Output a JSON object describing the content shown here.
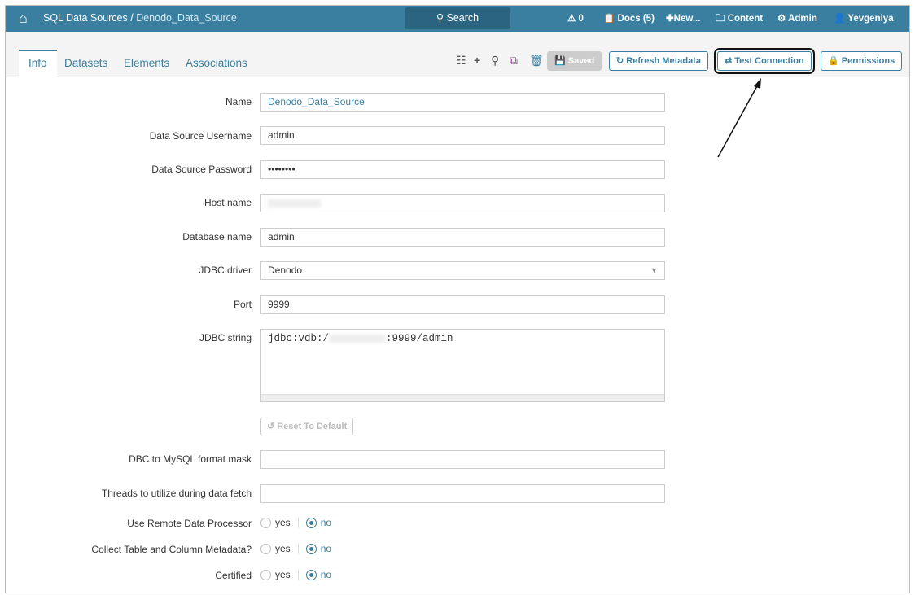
{
  "header": {
    "section": "SQL Data Sources",
    "separator": " / ",
    "current": "Denodo_Data_Source",
    "search": "Search",
    "alerts": "0",
    "docs": "Docs (5)",
    "new": "New...",
    "content": "Content",
    "admin": "Admin",
    "user": "Yevgeniya"
  },
  "tabs": [
    "Info",
    "Datasets",
    "Elements",
    "Associations"
  ],
  "toolbar": {
    "saved": "Saved",
    "refresh": "Refresh Metadata",
    "test": "Test Connection",
    "permissions": "Permissions"
  },
  "form": {
    "name_label": "Name",
    "name": "Denodo_Data_Source",
    "user_label": "Data Source Username",
    "user": "admin",
    "pass_label": "Data Source Password",
    "pass": "••••••••",
    "host_label": "Host name",
    "db_label": "Database name",
    "db": "admin",
    "driver_label": "JDBC driver",
    "driver": "Denodo",
    "port_label": "Port",
    "port": "9999",
    "jdbc_label": "JDBC string",
    "jdbc_prefix": "jdbc:vdb:/",
    "jdbc_suffix": ":9999/admin",
    "reset": "Reset To Default",
    "mask_label": "DBC to MySQL format mask",
    "threads_label": "Threads to utilize during data fetch",
    "radios": [
      {
        "label": "Use Remote Data Processor",
        "yes": "yes",
        "no": "no"
      },
      {
        "label": "Collect Table and Column Metadata?",
        "yes": "yes",
        "no": "no"
      },
      {
        "label": "Certified",
        "yes": "yes",
        "no": "no"
      }
    ]
  },
  "colors": {
    "brand": "#3a7fa0"
  }
}
